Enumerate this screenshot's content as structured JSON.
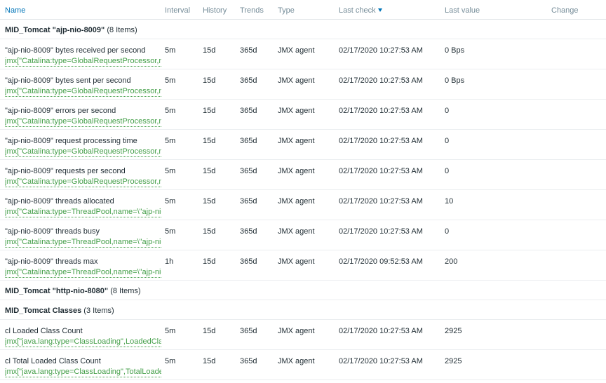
{
  "columns": {
    "name": "Name",
    "interval": "Interval",
    "history": "History",
    "trends": "Trends",
    "type": "Type",
    "last_check": "Last check",
    "last_value": "Last value",
    "change": "Change"
  },
  "groups": [
    {
      "name": "MID_Tomcat \"ajp-nio-8009\"",
      "count": "(8 Items)"
    },
    {
      "name": "MID_Tomcat \"http-nio-8080\"",
      "count": "(8 Items)"
    },
    {
      "name": "MID_Tomcat Classes",
      "count": "(3 Items)"
    }
  ],
  "items": [
    {
      "name": "\"ajp-nio-8009\" bytes received per second",
      "key": "jmx[\"Catalina:type=GlobalRequestProcessor,name=\\\"ajp-nio-8009\\\"\",bytesReceived]",
      "interval": "5m",
      "history": "15d",
      "trends": "365d",
      "type": "JMX agent",
      "last_check": "02/17/2020 10:27:53 AM",
      "last_value": "0 Bps",
      "change": ""
    },
    {
      "name": "\"ajp-nio-8009\" bytes sent per second",
      "key": "jmx[\"Catalina:type=GlobalRequestProcessor,name=\\\"ajp-nio-8009\\\"\",bytesSent]",
      "interval": "5m",
      "history": "15d",
      "trends": "365d",
      "type": "JMX agent",
      "last_check": "02/17/2020 10:27:53 AM",
      "last_value": "0 Bps",
      "change": ""
    },
    {
      "name": "\"ajp-nio-8009\" errors per second",
      "key": "jmx[\"Catalina:type=GlobalRequestProcessor,name=\\\"ajp-nio-8009\\\"\",errorCount]",
      "interval": "5m",
      "history": "15d",
      "trends": "365d",
      "type": "JMX agent",
      "last_check": "02/17/2020 10:27:53 AM",
      "last_value": "0",
      "change": ""
    },
    {
      "name": "\"ajp-nio-8009\" request processing time",
      "key": "jmx[\"Catalina:type=GlobalRequestProcessor,name=\\\"ajp-nio-8009\\\"\",processingTime]",
      "interval": "5m",
      "history": "15d",
      "trends": "365d",
      "type": "JMX agent",
      "last_check": "02/17/2020 10:27:53 AM",
      "last_value": "0",
      "change": ""
    },
    {
      "name": "\"ajp-nio-8009\" requests per second",
      "key": "jmx[\"Catalina:type=GlobalRequestProcessor,name=\\\"ajp-nio-8009\\\"\",requestCount]",
      "interval": "5m",
      "history": "15d",
      "trends": "365d",
      "type": "JMX agent",
      "last_check": "02/17/2020 10:27:53 AM",
      "last_value": "0",
      "change": ""
    },
    {
      "name": "\"ajp-nio-8009\" threads allocated",
      "key": "jmx[\"Catalina:type=ThreadPool,name=\\\"ajp-nio-8009\\\"\",currentThreadCount]",
      "interval": "5m",
      "history": "15d",
      "trends": "365d",
      "type": "JMX agent",
      "last_check": "02/17/2020 10:27:53 AM",
      "last_value": "10",
      "change": ""
    },
    {
      "name": "\"ajp-nio-8009\" threads busy",
      "key": "jmx[\"Catalina:type=ThreadPool,name=\\\"ajp-nio-8009\\\"\",currentThreadsBusy]",
      "interval": "5m",
      "history": "15d",
      "trends": "365d",
      "type": "JMX agent",
      "last_check": "02/17/2020 10:27:53 AM",
      "last_value": "0",
      "change": ""
    },
    {
      "name": "\"ajp-nio-8009\" threads max",
      "key": "jmx[\"Catalina:type=ThreadPool,name=\\\"ajp-nio-8009\\\"\",maxThreads]",
      "interval": "1h",
      "history": "15d",
      "trends": "365d",
      "type": "JMX agent",
      "last_check": "02/17/2020 09:52:53 AM",
      "last_value": "200",
      "change": ""
    },
    {
      "name": "cl Loaded Class Count",
      "key": "jmx[\"java.lang:type=ClassLoading\",LoadedClassCount]",
      "interval": "5m",
      "history": "15d",
      "trends": "365d",
      "type": "JMX agent",
      "last_check": "02/17/2020 10:27:53 AM",
      "last_value": "2925",
      "change": ""
    },
    {
      "name": "cl Total Loaded Class Count",
      "key": "jmx[\"java.lang:type=ClassLoading\",TotalLoadedClassCount]",
      "interval": "5m",
      "history": "15d",
      "trends": "365d",
      "type": "JMX agent",
      "last_check": "02/17/2020 10:27:53 AM",
      "last_value": "2925",
      "change": ""
    }
  ]
}
